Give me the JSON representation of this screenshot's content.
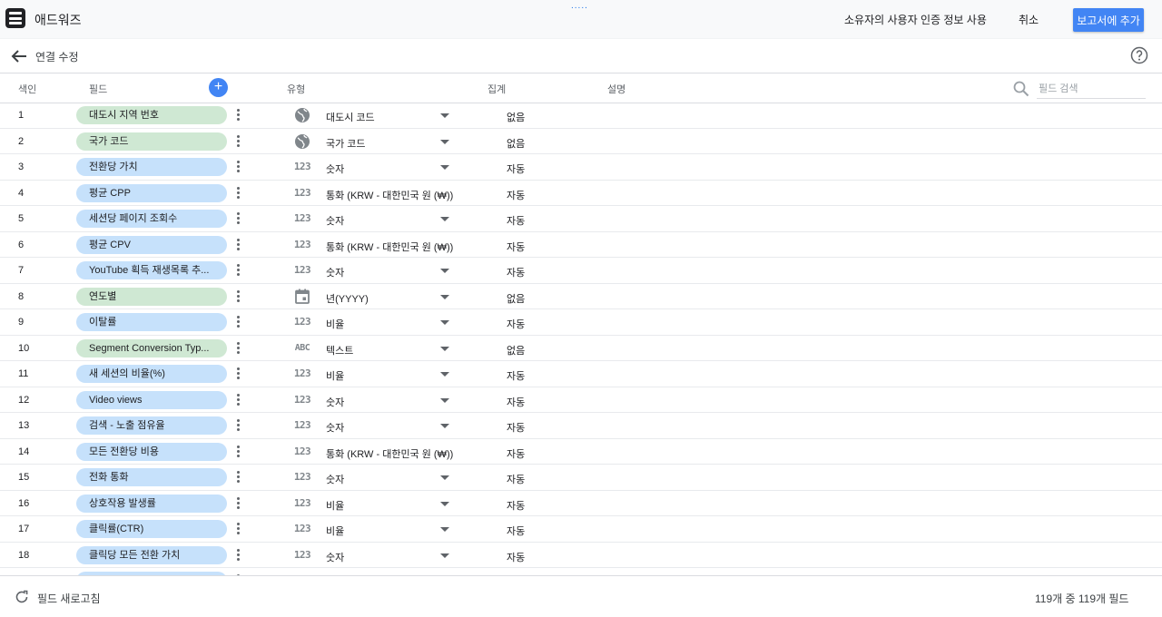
{
  "app": {
    "title": "애드워즈",
    "drag_handle": "....."
  },
  "toolbar": {
    "use_owner_credentials": "소유자의 사용자 인증 정보 사용",
    "cancel": "취소",
    "add_to_report": "보고서에 추가"
  },
  "header": {
    "title": "연결 수정"
  },
  "columns": {
    "index": "색인",
    "field": "필드",
    "add_field": "+",
    "type": "유형",
    "aggregation": "집계",
    "description": "설명"
  },
  "search": {
    "placeholder": "필드 검색",
    "value": ""
  },
  "rows": [
    {
      "index": "1",
      "field": "대도시 지역 번호",
      "kind": "dimension",
      "type_icon": "globe-icon",
      "type": "대도시 코드",
      "has_dropdown": true,
      "aggregation": "없음"
    },
    {
      "index": "2",
      "field": "국가 코드",
      "kind": "dimension",
      "type_icon": "globe-icon",
      "type": "국가 코드",
      "has_dropdown": true,
      "aggregation": "없음"
    },
    {
      "index": "3",
      "field": "전환당 가치",
      "kind": "metric",
      "type_icon": "number-icon",
      "type": "숫자",
      "has_dropdown": true,
      "aggregation": "자동"
    },
    {
      "index": "4",
      "field": "평균 CPP",
      "kind": "metric",
      "type_icon": "number-icon",
      "type": "통화 (KRW - 대한민국 원 (₩))",
      "has_dropdown": false,
      "aggregation": "자동"
    },
    {
      "index": "5",
      "field": "세션당 페이지 조회수",
      "kind": "metric",
      "type_icon": "number-icon",
      "type": "숫자",
      "has_dropdown": true,
      "aggregation": "자동"
    },
    {
      "index": "6",
      "field": "평균 CPV",
      "kind": "metric",
      "type_icon": "number-icon",
      "type": "통화 (KRW - 대한민국 원 (₩))",
      "has_dropdown": false,
      "aggregation": "자동"
    },
    {
      "index": "7",
      "field": "YouTube 획득 재생목록 추...",
      "kind": "metric",
      "type_icon": "number-icon",
      "type": "숫자",
      "has_dropdown": true,
      "aggregation": "자동"
    },
    {
      "index": "8",
      "field": "연도별",
      "kind": "dimension",
      "type_icon": "calendar-icon",
      "type": "년(YYYY)",
      "has_dropdown": true,
      "aggregation": "없음"
    },
    {
      "index": "9",
      "field": "이탈률",
      "kind": "metric",
      "type_icon": "number-icon",
      "type": "비율",
      "has_dropdown": true,
      "aggregation": "자동"
    },
    {
      "index": "10",
      "field": "Segment Conversion Typ...",
      "kind": "dimension",
      "type_icon": "text-icon",
      "type": "텍스트",
      "has_dropdown": true,
      "aggregation": "없음"
    },
    {
      "index": "11",
      "field": "새 세션의 비율(%)",
      "kind": "metric",
      "type_icon": "number-icon",
      "type": "비율",
      "has_dropdown": true,
      "aggregation": "자동"
    },
    {
      "index": "12",
      "field": "Video views",
      "kind": "metric",
      "type_icon": "number-icon",
      "type": "숫자",
      "has_dropdown": true,
      "aggregation": "자동"
    },
    {
      "index": "13",
      "field": "검색 - 노출 점유율",
      "kind": "metric",
      "type_icon": "number-icon",
      "type": "숫자",
      "has_dropdown": true,
      "aggregation": "자동"
    },
    {
      "index": "14",
      "field": "모든 전환당 비용",
      "kind": "metric",
      "type_icon": "number-icon",
      "type": "통화 (KRW - 대한민국 원 (₩))",
      "has_dropdown": false,
      "aggregation": "자동"
    },
    {
      "index": "15",
      "field": "전화 통화",
      "kind": "metric",
      "type_icon": "number-icon",
      "type": "숫자",
      "has_dropdown": true,
      "aggregation": "자동"
    },
    {
      "index": "16",
      "field": "상호작용 발생률",
      "kind": "metric",
      "type_icon": "number-icon",
      "type": "비율",
      "has_dropdown": true,
      "aggregation": "자동"
    },
    {
      "index": "17",
      "field": "클릭률(CTR)",
      "kind": "metric",
      "type_icon": "number-icon",
      "type": "비율",
      "has_dropdown": true,
      "aggregation": "자동"
    },
    {
      "index": "18",
      "field": "클릭당 모든 전환 가치",
      "kind": "metric",
      "type_icon": "number-icon",
      "type": "숫자",
      "has_dropdown": true,
      "aggregation": "자동"
    },
    {
      "index": "",
      "field": "",
      "kind": "metric",
      "type_icon": "",
      "type": "",
      "has_dropdown": false,
      "aggregation": ""
    }
  ],
  "footer": {
    "refresh_fields": "필드 새로고침",
    "field_count": "119개 중 119개 필드"
  },
  "colors": {
    "accent": "#4285f4",
    "dimension_chip": "#cfe8d3",
    "metric_chip": "#c6e1fb"
  }
}
